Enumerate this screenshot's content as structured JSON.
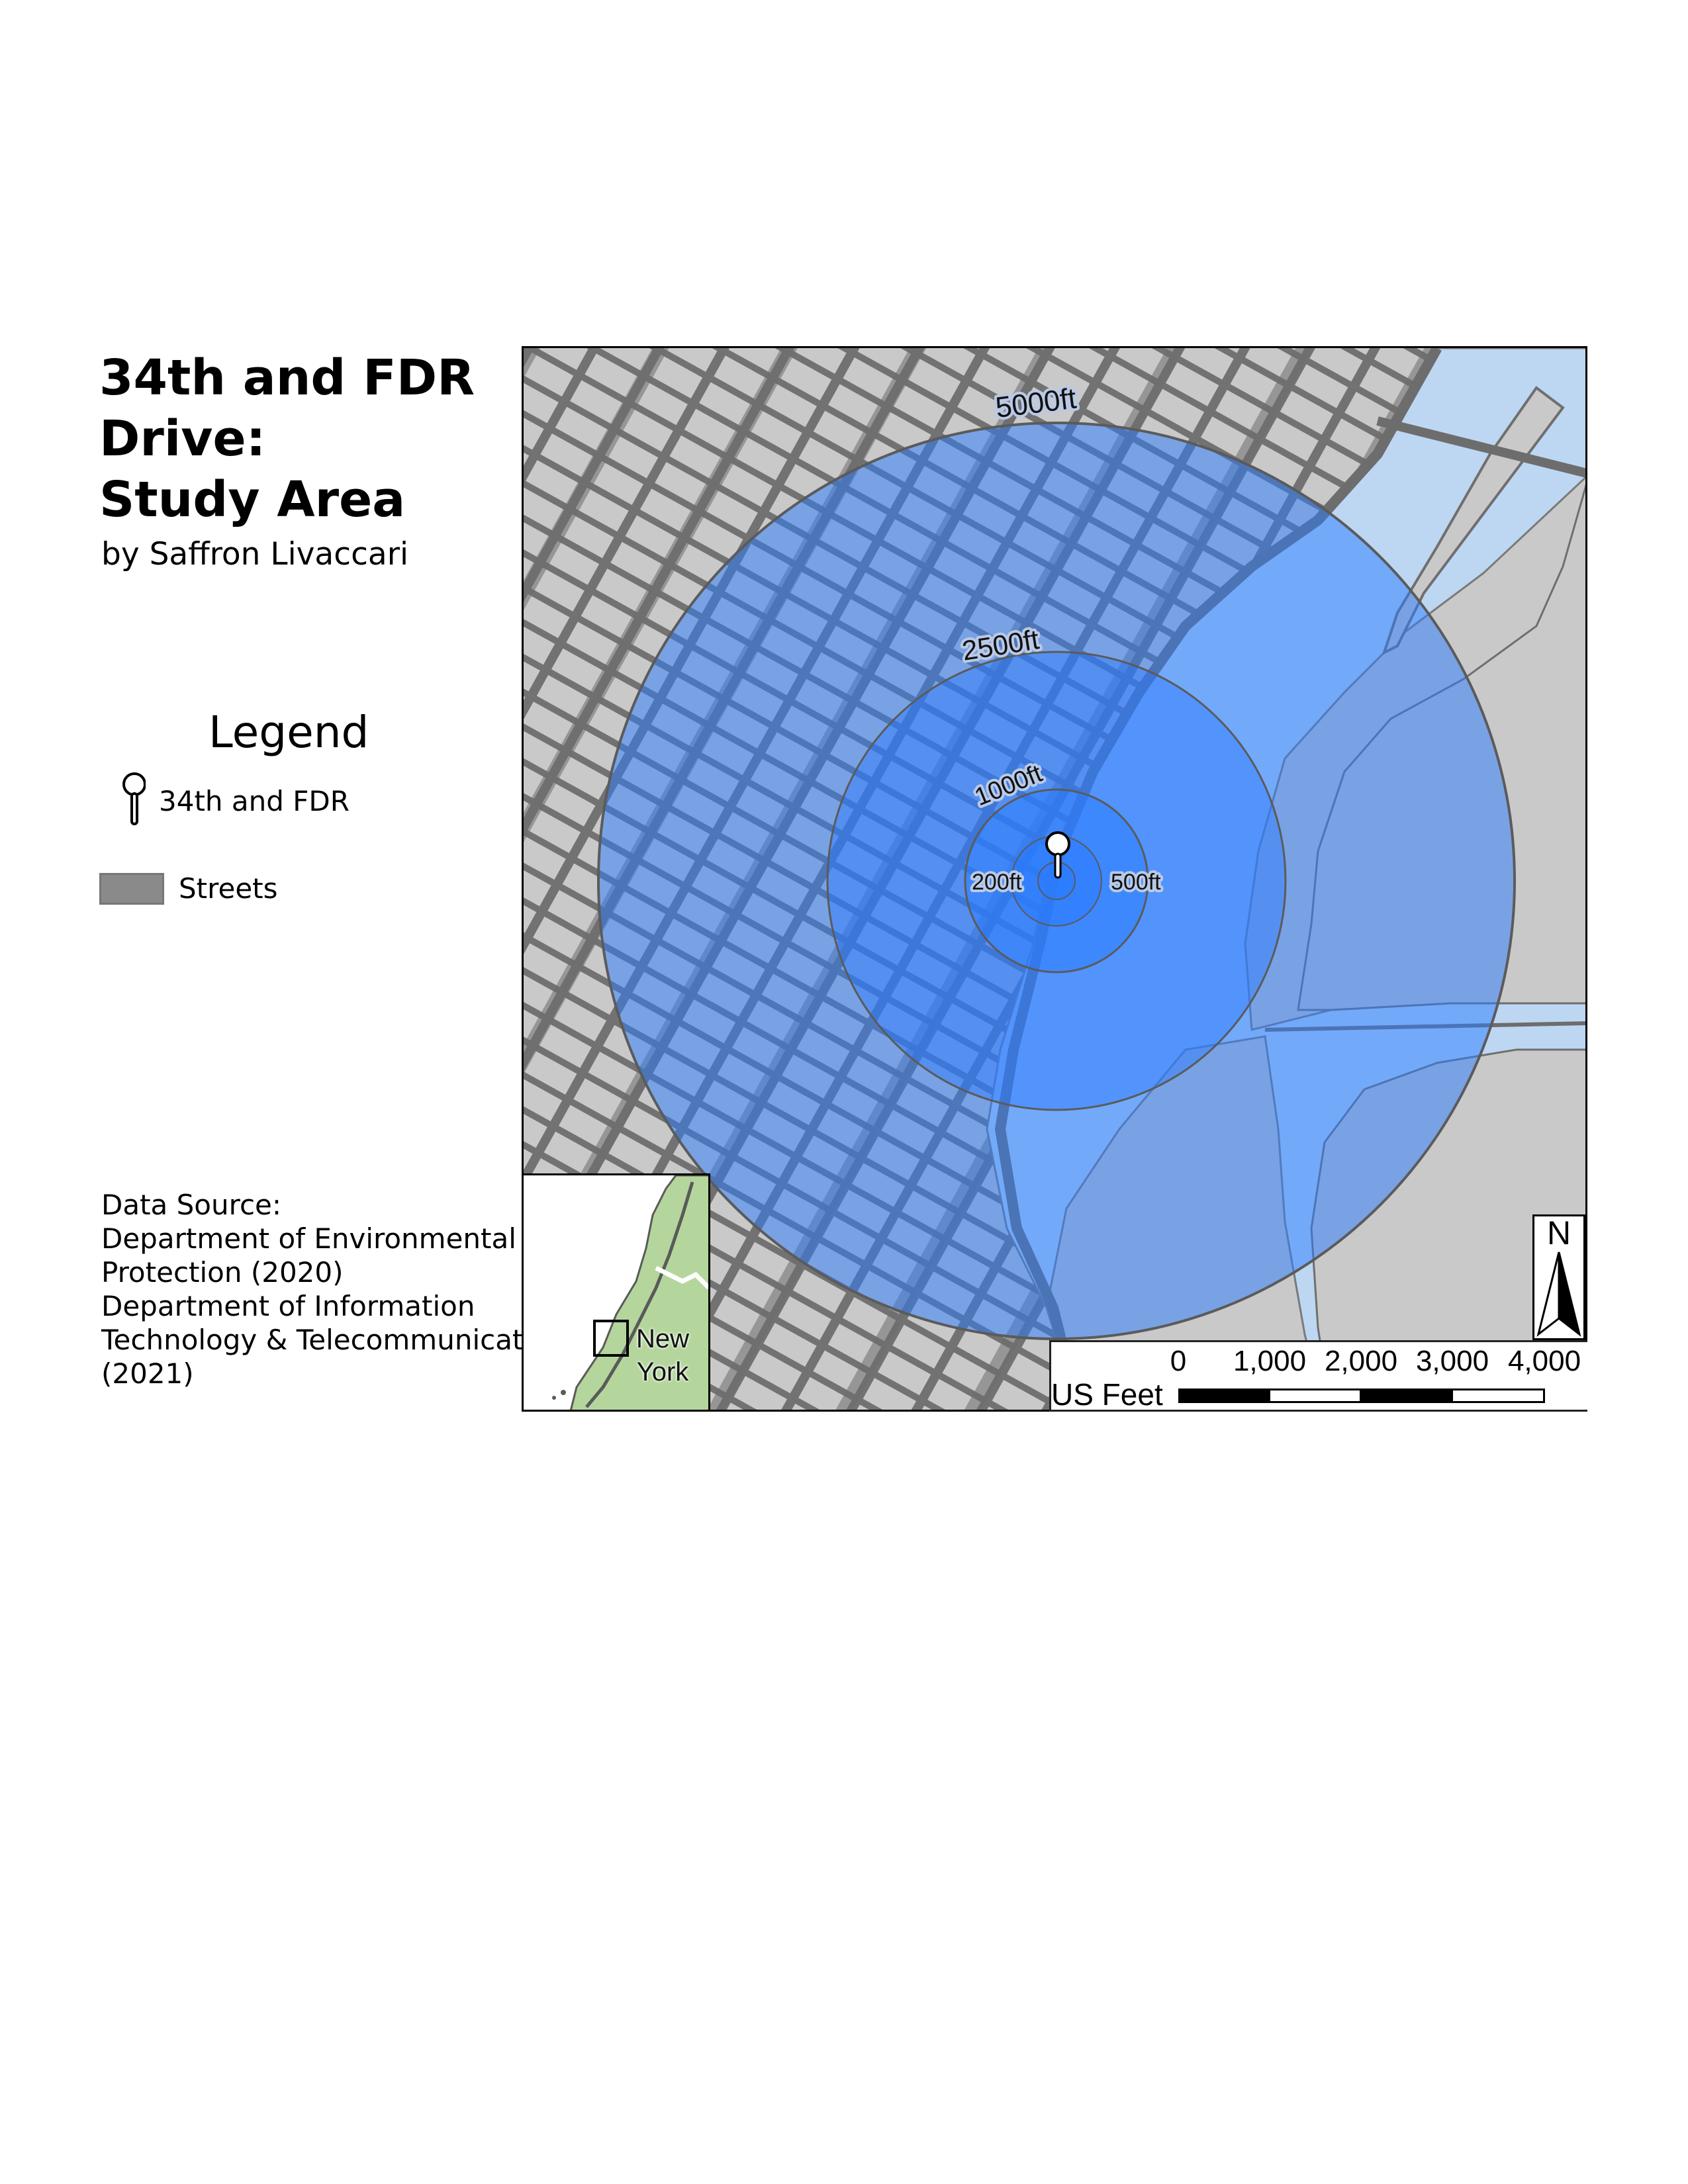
{
  "title": {
    "line1": "34th and FDR",
    "line2": "Drive:",
    "line3": "Study Area"
  },
  "author": "by Saffron Livaccari",
  "legend": {
    "heading": "Legend",
    "items": [
      {
        "label": "34th and FDR",
        "icon": "map-pin-icon"
      },
      {
        "label": "Streets",
        "icon": "street-swatch",
        "color": "#8a8a8a"
      }
    ]
  },
  "data_source": {
    "lines": [
      "Data Source:",
      "Department of Environmental",
      "Protection (2020)",
      "Department of Information",
      "Technology & Telecommunications",
      "(2021)"
    ]
  },
  "map": {
    "buffer_rings": [
      {
        "label": "5000ft",
        "radius_ft": 5000
      },
      {
        "label": "2500ft",
        "radius_ft": 2500
      },
      {
        "label": "1000ft",
        "radius_ft": 1000
      },
      {
        "label": "500ft",
        "radius_ft": 500
      },
      {
        "label": "200ft",
        "radius_ft": 200
      }
    ],
    "colors": {
      "land": "#c9c9c9",
      "water": "#bdd7f2",
      "streets": "#727272",
      "buffer": "#2a7bff",
      "inset_land": "#b4d69c"
    },
    "inset": {
      "line1": "New",
      "line2": "York"
    },
    "scale_bar": {
      "ticks": [
        "0",
        "1,000",
        "2,000",
        "3,000",
        "4,000"
      ],
      "unit": "US Feet"
    },
    "north_arrow": "N"
  }
}
